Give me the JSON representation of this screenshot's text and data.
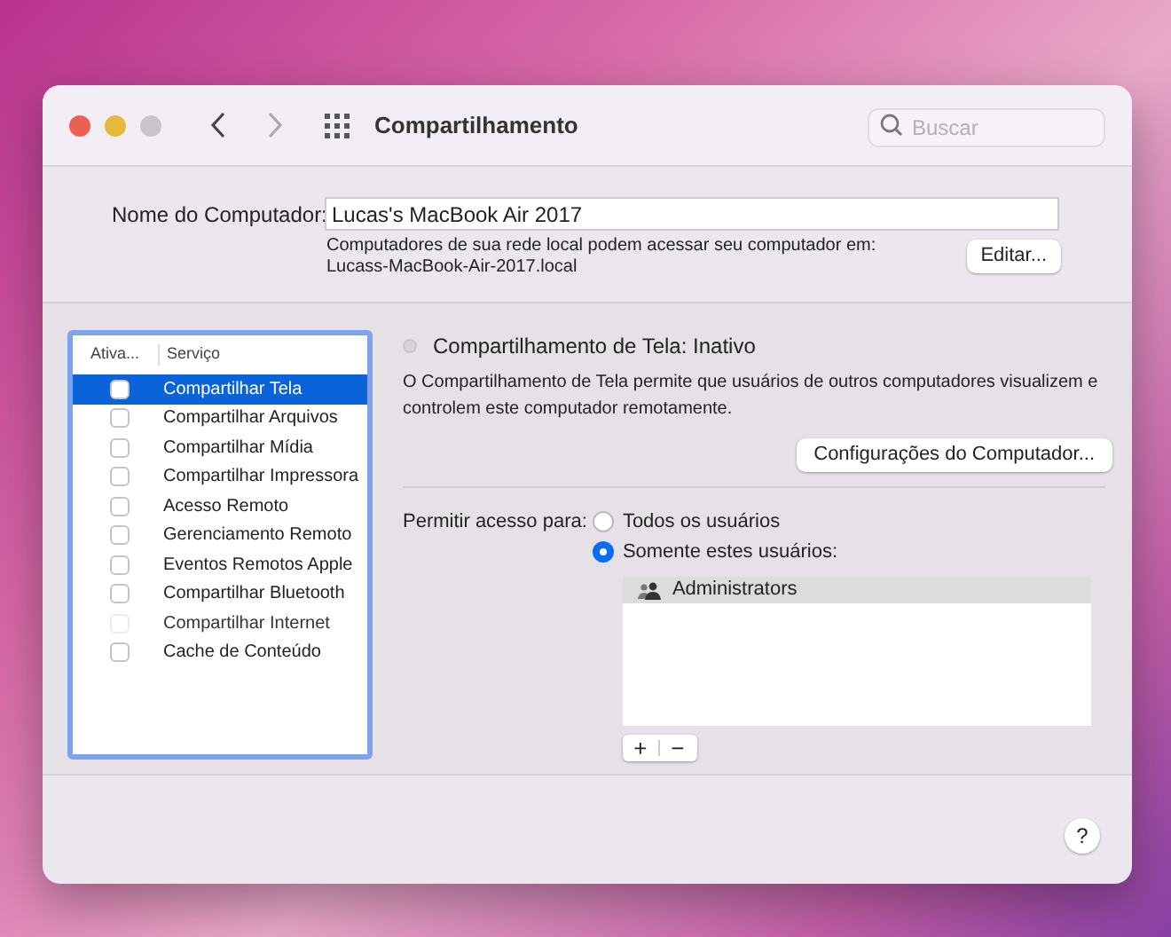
{
  "window": {
    "title": "Compartilhamento"
  },
  "search": {
    "placeholder": "Buscar"
  },
  "computer_name": {
    "label": "Nome do Computador:",
    "value": "Lucas's MacBook Air 2017",
    "note": "Computadores de sua rede local podem acessar seu computador em:",
    "address": "Lucass-MacBook-Air-2017.local",
    "edit_button": "Editar..."
  },
  "services": {
    "columns": [
      "Ativa...",
      "Serviço"
    ],
    "rows": [
      {
        "name": "Compartilhar Tela",
        "checked": false,
        "disabled": false,
        "selected": true
      },
      {
        "name": "Compartilhar Arquivos",
        "checked": false,
        "disabled": false,
        "selected": false
      },
      {
        "name": "Compartilhar Mídia",
        "checked": false,
        "disabled": false,
        "selected": false
      },
      {
        "name": "Compartilhar Impressora",
        "checked": false,
        "disabled": false,
        "selected": false
      },
      {
        "name": "Acesso Remoto",
        "checked": false,
        "disabled": false,
        "selected": false
      },
      {
        "name": "Gerenciamento Remoto",
        "checked": false,
        "disabled": false,
        "selected": false
      },
      {
        "name": "Eventos Remotos Apple",
        "checked": false,
        "disabled": false,
        "selected": false
      },
      {
        "name": "Compartilhar Bluetooth",
        "checked": false,
        "disabled": false,
        "selected": false
      },
      {
        "name": "Compartilhar Internet",
        "checked": false,
        "disabled": true,
        "selected": false
      },
      {
        "name": "Cache de Conteúdo",
        "checked": false,
        "disabled": false,
        "selected": false
      }
    ]
  },
  "detail": {
    "status": "Compartilhamento de Tela: Inativo",
    "on": false,
    "description": "O Compartilhamento de Tela permite que usuários de outros computadores visualizem e controlem este computador remotamente.",
    "settings_button": "Configurações do Computador...",
    "access_label": "Permitir acesso para:",
    "access_options": [
      {
        "label": "Todos os usuários",
        "selected": false
      },
      {
        "label": "Somente estes usuários:",
        "selected": true
      }
    ],
    "users": [
      {
        "name": "Administrators",
        "selected": true
      }
    ],
    "add_button": "+",
    "remove_button": "−"
  },
  "help_button": "?"
}
